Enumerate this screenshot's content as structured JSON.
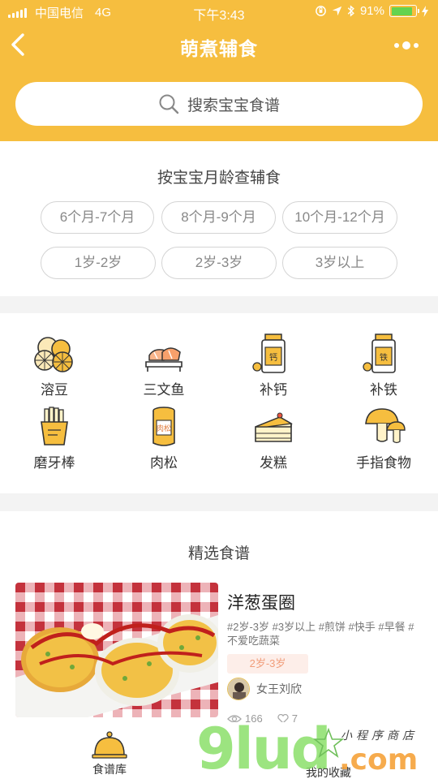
{
  "status_bar": {
    "carrier": "中国电信",
    "network": "4G",
    "time": "下午3:43",
    "battery": "91%",
    "battery_level": 0.91
  },
  "nav": {
    "title": "萌煮辅食",
    "back_icon": "chevron-left-icon",
    "more_icon": "more-dots-icon"
  },
  "search": {
    "placeholder": "搜索宝宝食谱",
    "icon": "search-icon"
  },
  "age_section": {
    "title": "按宝宝月龄查辅食",
    "ranges": [
      "6个月-7个月",
      "8个月-9个月",
      "10个月-12个月",
      "1岁-2岁",
      "2岁-3岁",
      "3岁以上"
    ]
  },
  "categories": [
    {
      "label": "溶豆",
      "icon": "lemon-slices-icon"
    },
    {
      "label": "三文鱼",
      "icon": "salmon-sushi-icon"
    },
    {
      "label": "补钙",
      "icon": "calcium-bottle-icon"
    },
    {
      "label": "补铁",
      "icon": "iron-bottle-icon"
    },
    {
      "label": "磨牙棒",
      "icon": "fries-icon"
    },
    {
      "label": "肉松",
      "icon": "meat-floss-jar-icon"
    },
    {
      "label": "发糕",
      "icon": "cake-icon"
    },
    {
      "label": "手指食物",
      "icon": "mushroom-icon"
    }
  ],
  "featured": {
    "title": "精选食谱",
    "recipe": {
      "name": "洋葱蛋圈",
      "tags": "#2岁-3岁 #3岁以上 #煎饼 #快手 #早餐 #不爱吃蔬菜",
      "age_badge": "2岁-3岁",
      "author": "女王刘欣",
      "views": "166",
      "likes": "7"
    },
    "jar_label": "肉松",
    "calcium_label": "钙",
    "iron_label": "铁"
  },
  "tabbar": {
    "tabs": [
      {
        "label": "食谱库",
        "icon": "cloche-icon",
        "active": true
      },
      {
        "label": "我的收藏",
        "icon": "",
        "active": false
      }
    ]
  },
  "watermark": {
    "text": "9lud",
    "suffix": ".com",
    "tagline": "小程序商店"
  },
  "colors": {
    "primary": "#f6be3f",
    "pill_border": "#d4d4d4",
    "badge_bg": "#fdeee9",
    "badge_text": "#f19d7a"
  }
}
